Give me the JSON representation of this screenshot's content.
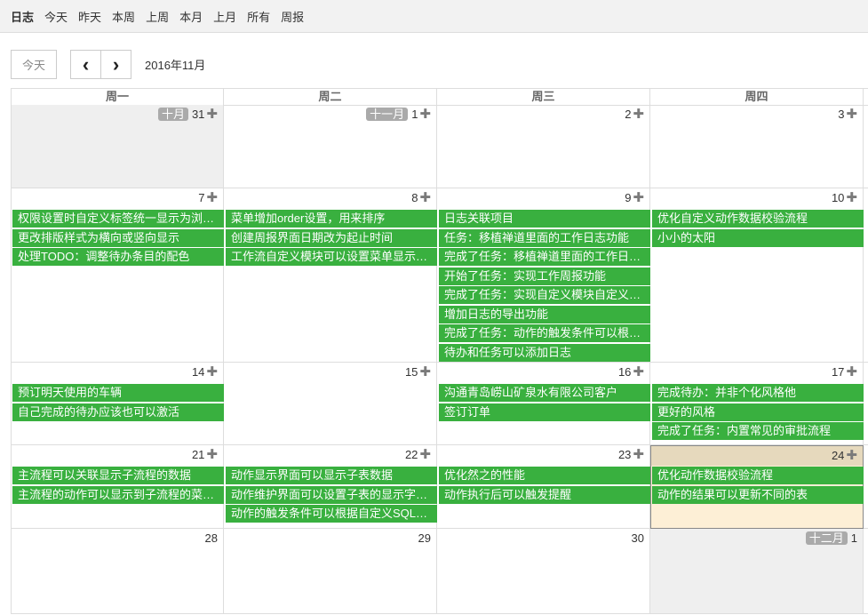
{
  "nav": [
    "日志",
    "今天",
    "昨天",
    "本周",
    "上周",
    "本月",
    "上月",
    "所有",
    "周报"
  ],
  "toolbar": {
    "today": "今天",
    "prev": "‹",
    "next": "›",
    "title": "2016年11月"
  },
  "weekdays": [
    "周一",
    "周二",
    "周三",
    "周四",
    ""
  ],
  "weeks": [
    [
      {
        "day": "31",
        "month": "十月",
        "other": true,
        "events": []
      },
      {
        "day": "1",
        "month": "十一月",
        "events": []
      },
      {
        "day": "2",
        "events": []
      },
      {
        "day": "3",
        "events": []
      },
      {
        "day": "",
        "events": []
      }
    ],
    [
      {
        "day": "7",
        "events": [
          "权限设置时自定义标签统一显示为浏…",
          "更改排版样式为横向或竖向显示",
          "处理TODO：调整待办条目的配色"
        ]
      },
      {
        "day": "8",
        "events": [
          "菜单增加order设置，用来排序",
          "创建周报界面日期改为起止时间",
          "工作流自定义模块可以设置菜单显示…"
        ]
      },
      {
        "day": "9",
        "events": [
          "日志关联项目",
          "任务：移植禅道里面的工作日志功能",
          "完成了任务：移植禅道里面的工作日…",
          "开始了任务：实现工作周报功能",
          "完成了任务：实现自定义模块自定义…",
          "增加日志的导出功能",
          "完成了任务：动作的触发条件可以根…",
          "待办和任务可以添加日志"
        ]
      },
      {
        "day": "10",
        "events": [
          "优化自定义动作数据校验流程",
          "小小的太阳"
        ]
      },
      {
        "day": "",
        "events": []
      }
    ],
    [
      {
        "day": "14",
        "events": [
          "预订明天使用的车辆",
          "自己完成的待办应该也可以激活"
        ]
      },
      {
        "day": "15",
        "events": []
      },
      {
        "day": "16",
        "events": [
          "沟通青岛崂山矿泉水有限公司客户",
          "签订订单"
        ]
      },
      {
        "day": "17",
        "events": [
          "完成待办：并非个化风格他",
          "更好的风格",
          "完成了任务：内置常见的审批流程"
        ]
      },
      {
        "day": "",
        "events": []
      }
    ],
    [
      {
        "day": "21",
        "events": [
          "主流程可以关联显示子流程的数据",
          "主流程的动作可以显示到子流程的菜…"
        ]
      },
      {
        "day": "22",
        "events": [
          "动作显示界面可以显示子表数据",
          "动作维护界面可以设置子表的显示字…",
          "动作的触发条件可以根据自定义SQL…"
        ]
      },
      {
        "day": "23",
        "events": [
          "优化然之的性能",
          "动作执行后可以触发提醒"
        ]
      },
      {
        "day": "24",
        "today": true,
        "events": [
          "优化动作数据校验流程",
          "动作的结果可以更新不同的表"
        ]
      },
      {
        "day": "",
        "events": []
      }
    ],
    [
      {
        "day": "28",
        "noplus": true,
        "events": []
      },
      {
        "day": "29",
        "noplus": true,
        "events": []
      },
      {
        "day": "30",
        "noplus": true,
        "events": []
      },
      {
        "day": "1",
        "month": "十二月",
        "other": true,
        "noplus": true,
        "events": []
      },
      {
        "day": "",
        "events": []
      }
    ]
  ]
}
